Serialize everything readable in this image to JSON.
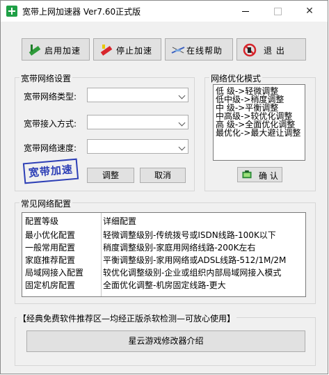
{
  "window": {
    "title": "宽带上网加速器  Ver7.60正式版"
  },
  "toolbar": {
    "start_label": "启用加速",
    "stop_label": "停止加速",
    "help_label": "在线帮助",
    "exit_label": "退  出"
  },
  "settings": {
    "group_title": "宽带网络设置",
    "type_label": "宽带网络类型:",
    "access_label": "宽带接入方式:",
    "speed_label": "宽带网络速度:",
    "type_value": "",
    "access_value": "",
    "speed_value": "",
    "stamp_text": "宽带加速",
    "adjust_label": "调整",
    "cancel_label": "取消"
  },
  "optimize": {
    "group_title": "网络优化模式",
    "modes": [
      "低  级->轻微调整",
      "低中级->稍度调整",
      "中  级->平衡调整",
      "中高级->较优化调整",
      "高  级->全面优化调整",
      "最优化->最大避让调整"
    ],
    "confirm_label": "确 认"
  },
  "common": {
    "group_title": "常见网络配置",
    "headers": [
      "配置等级",
      "详细配置"
    ],
    "rows": [
      [
        "最小优化配置",
        "轻微调整级别-传统拨号或ISDN线路-100K以下"
      ],
      [
        "一般常用配置",
        "稍度调整级别-家庭用网络线路-200K左右"
      ],
      [
        "家庭推荐配置",
        "平衡调整级别-家用网络或ADSL线路-512/1M/2M"
      ],
      [
        "局域网接入配置",
        "较优化调整级别-企业或组织内部局域网接入模式"
      ],
      [
        "固定机房配置",
        "全面优化调整-机房固定线路-更大"
      ]
    ]
  },
  "recommend": {
    "group_title": "【经典免费软件推荐区—均经正版杀软检测—可放心使用】",
    "button_label": "星云游戏修改器介绍"
  }
}
